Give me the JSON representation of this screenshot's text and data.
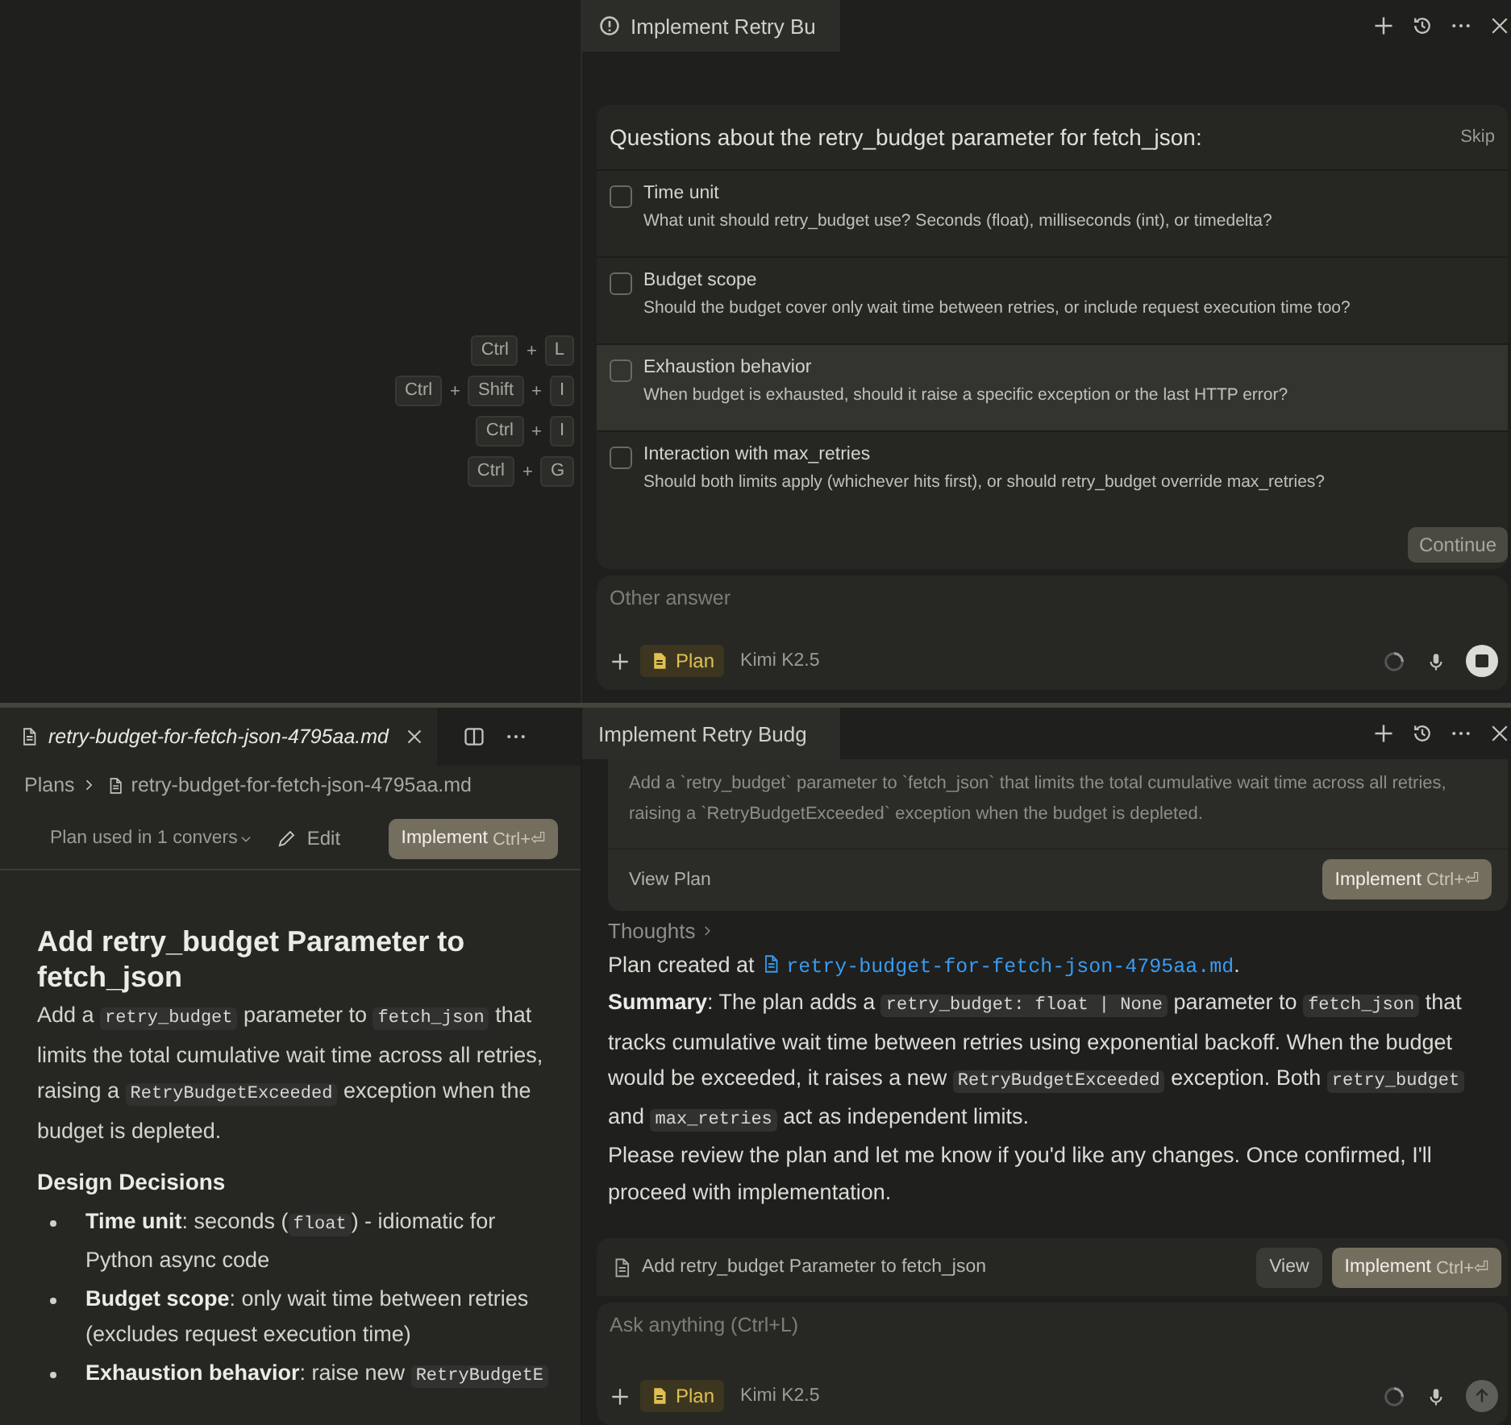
{
  "top": {
    "shortcuts": [
      {
        "keys": [
          "Ctrl",
          "L"
        ],
        "joiner": "+"
      },
      {
        "keys": [
          "Ctrl",
          "Shift",
          "I"
        ],
        "joiner": "+"
      },
      {
        "keys": [
          "Ctrl",
          "I"
        ],
        "joiner": "+"
      },
      {
        "keys": [
          "Ctrl",
          "G"
        ],
        "joiner": "+"
      }
    ],
    "chat": {
      "tab": {
        "title": "Implement Retry Bu",
        "selected": true,
        "warning": true
      },
      "questions": {
        "title": "Questions about the retry_budget parameter for fetch_json:",
        "skip": "Skip",
        "items": [
          {
            "title": "Time unit",
            "text": "What unit should retry_budget use? Seconds (float), milliseconds (int), or timedelta?",
            "checked": false,
            "hovered": false
          },
          {
            "title": "Budget scope",
            "text": "Should the budget cover only wait time between retries, or include request execution time too?",
            "checked": false,
            "hovered": false
          },
          {
            "title": "Exhaustion behavior",
            "text": "When budget is exhausted, should it raise a specific exception or the last HTTP error?",
            "checked": false,
            "hovered": true
          },
          {
            "title": "Interaction with max_retries",
            "text": "Should both limits apply (whichever hits first), or should retry_budget override max_retries?",
            "checked": false,
            "hovered": false
          }
        ],
        "continue": "Continue"
      },
      "input": {
        "placeholder": "Other answer",
        "mode": "Plan",
        "model": "Kimi K2.5",
        "kind": "stop"
      }
    }
  },
  "bottom": {
    "editor": {
      "tab": {
        "title": "retry-budget-for-fetch-json-4795aa.md",
        "selected": true
      },
      "breadcrumb": [
        "Plans",
        "retry-budget-for-fetch-json-4795aa.md"
      ],
      "usage": "Plan used in 1 convers",
      "edit": "Edit",
      "implement": {
        "label": "Implement",
        "shortcut": "Ctrl+⏎"
      },
      "heading": "Add retry_budget Parameter to fetch_json",
      "intro": [
        {
          "kind": "text",
          "text": "Add a "
        },
        {
          "kind": "code",
          "text": "retry_budget"
        },
        {
          "kind": "text",
          "text": " parameter to "
        },
        {
          "kind": "code",
          "text": "fetch_json"
        },
        {
          "kind": "text",
          "text": " that limits the total cumulative wait time across all retries, raising a "
        },
        {
          "kind": "code",
          "text": "RetryBudgetExceeded"
        },
        {
          "kind": "text",
          "text": " exception when the budget is depleted."
        }
      ],
      "section": "Design Decisions",
      "bullets": [
        [
          {
            "kind": "text",
            "text": "**Time unit**: seconds ("
          },
          {
            "kind": "code",
            "text": "float"
          },
          {
            "kind": "text",
            "text": ") - idiomatic for Python async code"
          }
        ],
        [
          {
            "kind": "text",
            "text": "**Budget scope**: only wait time between retries (excludes request execution time)"
          }
        ],
        [
          {
            "kind": "text",
            "text": "**Exhaustion behavior**: raise new "
          },
          {
            "kind": "code",
            "text": "RetryBudgetE"
          }
        ]
      ]
    },
    "chat": {
      "tab": {
        "title": "Implement Retry Budg",
        "selected": true,
        "warning": false
      },
      "plan_card": {
        "text": "Add a `retry_budget` parameter to `fetch_json` that limits the total cumulative wait time across all retries, raising a `RetryBudgetExceeded` exception when the budget is depleted.",
        "view": "View Plan",
        "implement": {
          "label": "Implement",
          "shortcut": "Ctrl+⏎"
        }
      },
      "thoughts": "Thoughts",
      "message": [
        [
          {
            "kind": "text",
            "text": "Plan created at "
          },
          {
            "kind": "link",
            "text": "retry-budget-for-fetch-json-4795aa.md"
          },
          {
            "kind": "text",
            "text": "."
          }
        ],
        [
          {
            "kind": "text",
            "text": "**Summary**: The plan adds a "
          },
          {
            "kind": "code",
            "text": "retry_budget: float | None"
          },
          {
            "kind": "text",
            "text": " parameter to "
          },
          {
            "kind": "code",
            "text": "fetch_json"
          },
          {
            "kind": "text",
            "text": " that tracks cumulative wait time between retries using exponential backoff. When the budget would be exceeded, it raises a new "
          },
          {
            "kind": "code",
            "text": "RetryBudgetExceeded"
          },
          {
            "kind": "text",
            "text": " exception. Both "
          },
          {
            "kind": "code",
            "text": "retry_budget"
          },
          {
            "kind": "text",
            "text": " and "
          },
          {
            "kind": "code",
            "text": "max_retries"
          },
          {
            "kind": "text",
            "text": " act as independent limits."
          }
        ],
        [
          {
            "kind": "text",
            "text": "Please review the plan and let me know if you'd like any changes. Once confirmed, I'll proceed with implementation."
          }
        ]
      ],
      "plan_bar": {
        "title": "Add retry_budget Parameter to fetch_json",
        "view": "View",
        "implement": {
          "label": "Implement",
          "shortcut": "Ctrl+⏎"
        }
      },
      "input": {
        "placeholder": "Ask anything (Ctrl+L)",
        "mode": "Plan",
        "model": "Kimi K2.5",
        "kind": "send"
      }
    }
  }
}
